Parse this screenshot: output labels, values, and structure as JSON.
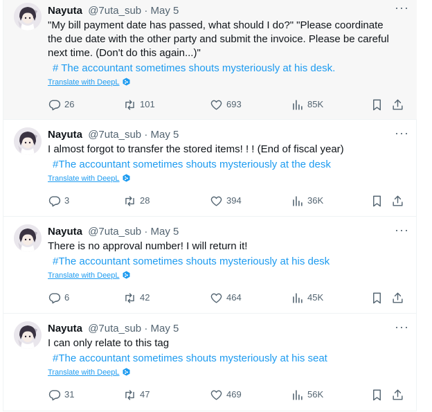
{
  "colors": {
    "link": "#1d9bf0",
    "muted": "#536471",
    "text": "#0f1419",
    "highlight_bg": "#f7f7f7"
  },
  "tweets": [
    {
      "name": "Nayuta",
      "handle": "@7uta_sub",
      "separator": "·",
      "date": "May 5",
      "more": "···",
      "lines": [
        "\"My bill payment date has passed, what should I do?\" \"Please coordinate",
        "the due date with the other party and submit the invoice. Please be careful",
        "next time. (Don't do this again...)\""
      ],
      "hashtag": "# The accountant sometimes shouts mysteriously at his desk.",
      "translate": "Translate with DeepL",
      "replies": "26",
      "retweets": "101",
      "likes": "693",
      "views": "85K"
    },
    {
      "name": "Nayuta",
      "handle": "@7uta_sub",
      "separator": "·",
      "date": "May 5",
      "more": "···",
      "lines": [
        "I almost forgot to transfer the stored items! ! ! (End of fiscal year)"
      ],
      "hashtag": "#The accountant sometimes shouts mysteriously at the desk",
      "translate": "Translate with DeepL",
      "replies": "3",
      "retweets": "28",
      "likes": "394",
      "views": "36K"
    },
    {
      "name": "Nayuta",
      "handle": "@7uta_sub",
      "separator": "·",
      "date": "May 5",
      "more": "···",
      "lines": [
        "There is no approval number! I will return it!"
      ],
      "hashtag": "#The accountant sometimes shouts mysteriously at his desk",
      "translate": "Translate with DeepL",
      "replies": "6",
      "retweets": "42",
      "likes": "464",
      "views": "45K"
    },
    {
      "name": "Nayuta",
      "handle": "@7uta_sub",
      "separator": "·",
      "date": "May 5",
      "more": "···",
      "lines": [
        "I can only relate to this tag"
      ],
      "hashtag": "#The accountant sometimes shouts mysteriously at his seat",
      "translate": "Translate with DeepL",
      "replies": "31",
      "retweets": "47",
      "likes": "469",
      "views": "56K"
    }
  ]
}
